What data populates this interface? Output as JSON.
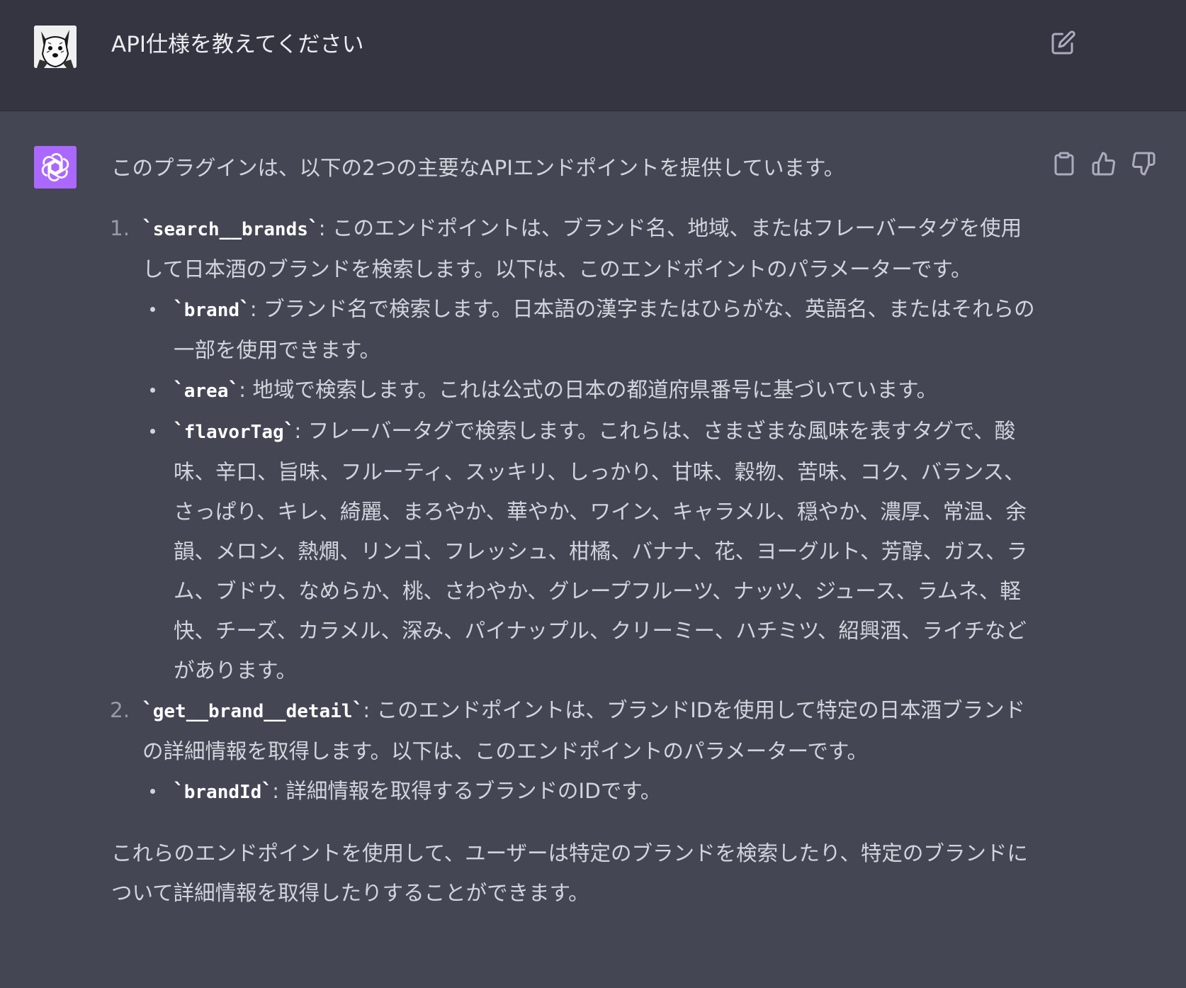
{
  "user_message": {
    "text": "API仕様を教えてください"
  },
  "assistant_message": {
    "intro": "このプラグインは、以下の2つの主要なAPIエンドポイントを提供しています。",
    "endpoints": [
      {
        "number": "1.",
        "name": "search__brands",
        "description": ": このエンドポイントは、ブランド名、地域、またはフレーバータグを使用して日本酒のブランドを検索します。以下は、このエンドポイントのパラメーターです。",
        "params": [
          {
            "name": "brand",
            "description": ": ブランド名で検索します。日本語の漢字またはひらがな、英語名、またはそれらの一部を使用できます。"
          },
          {
            "name": "area",
            "description": ": 地域で検索します。これは公式の日本の都道府県番号に基づいています。"
          },
          {
            "name": "flavorTag",
            "description": ": フレーバータグで検索します。これらは、さまざまな風味を表すタグで、酸味、辛口、旨味、フルーティ、スッキリ、しっかり、甘味、穀物、苦味、コク、バランス、さっぱり、キレ、綺麗、まろやか、華やか、ワイン、キャラメル、穏やか、濃厚、常温、余韻、メロン、熱燗、リンゴ、フレッシュ、柑橘、バナナ、花、ヨーグルト、芳醇、ガス、ラム、ブドウ、なめらか、桃、さわやか、グレープフルーツ、ナッツ、ジュース、ラムネ、軽快、チーズ、カラメル、深み、パイナップル、クリーミー、ハチミツ、紹興酒、ライチなどがあります。"
          }
        ]
      },
      {
        "number": "2.",
        "name": "get__brand__detail",
        "description": ": このエンドポイントは、ブランドIDを使用して特定の日本酒ブランドの詳細情報を取得します。以下は、このエンドポイントのパラメーターです。",
        "params": [
          {
            "name": "brandId",
            "description": ": 詳細情報を取得するブランドのIDです。"
          }
        ]
      }
    ],
    "closing": "これらのエンドポイントを使用して、ユーザーは特定のブランドを検索したり、特定のブランドについて詳細情報を取得したりすることができます。"
  },
  "icons": {
    "edit": "edit-icon",
    "copy": "clipboard-icon",
    "like": "thumbs-up-icon",
    "dislike": "thumbs-down-icon",
    "bot": "openai-logo-icon",
    "user": "dog-avatar"
  },
  "colors": {
    "user_bg": "#343541",
    "assistant_bg": "#444654",
    "bot_avatar": "#ab68ff"
  }
}
